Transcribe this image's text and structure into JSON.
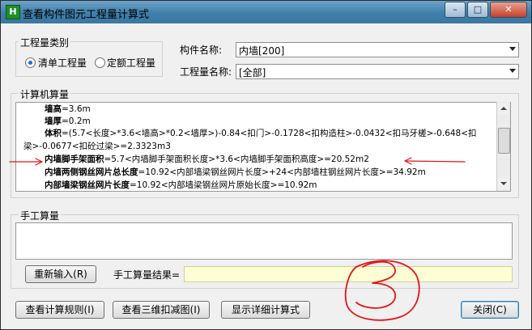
{
  "window": {
    "title": "查看构件图元工程量计算式",
    "app_icon": "H",
    "minimize": "–",
    "maximize": "□",
    "close": "✕"
  },
  "quantity_type": {
    "group_label": "工程量类别",
    "options": [
      {
        "label": "清单工程量",
        "selected": true
      },
      {
        "label": "定额工程量",
        "selected": false
      }
    ]
  },
  "component": {
    "name_label": "构件名称:",
    "name_value": "内墙[200]",
    "qty_label": "工程量名称:",
    "qty_value": "[全部]"
  },
  "computer_calc": {
    "group_label": "计算机算量",
    "lines": [
      {
        "name": "墙高",
        "expr": "=3.6m"
      },
      {
        "name": "墙厚",
        "expr": "=0.2m"
      },
      {
        "name": "体积",
        "expr": "=(5.7<长度>*3.6<墙高>*0.2<墙厚>)-0.84<扣门>-0.1728<扣构造柱>-0.0432<扣马牙槎>-0.648<扣"
      },
      {
        "name": "",
        "expr": "梁>-0.0677<扣砼过梁>=2.3323m3"
      },
      {
        "name": "内墙脚手架面积",
        "expr": "=5.7<内墙脚手架面积长度>*3.6<内墙脚手架面积高度>=20.52m2"
      },
      {
        "name": "内墙两侧钢丝网片总长度",
        "expr": "=10.92<内部墙梁钢丝网片长度>+24<内部墙柱钢丝网片长度>=34.92m"
      },
      {
        "name": "内部墙梁钢丝网片长度",
        "expr": "=10.92<内部墙梁钢丝网片原始长度>=10.92m"
      }
    ]
  },
  "manual_calc": {
    "group_label": "手工算量",
    "reenter_button": "重新输入(R)",
    "result_label": "手工算量结果=",
    "result_value": ""
  },
  "footer": {
    "rules_button": "查看计算规则(I)",
    "view3d_button": "查看三维扣减图(I)",
    "detail_button": "显示详细计算式",
    "close_button": "关闭(C)"
  },
  "annotation": {
    "color": "#e0161b",
    "scribble_icon": "handwritten-3-icon"
  }
}
